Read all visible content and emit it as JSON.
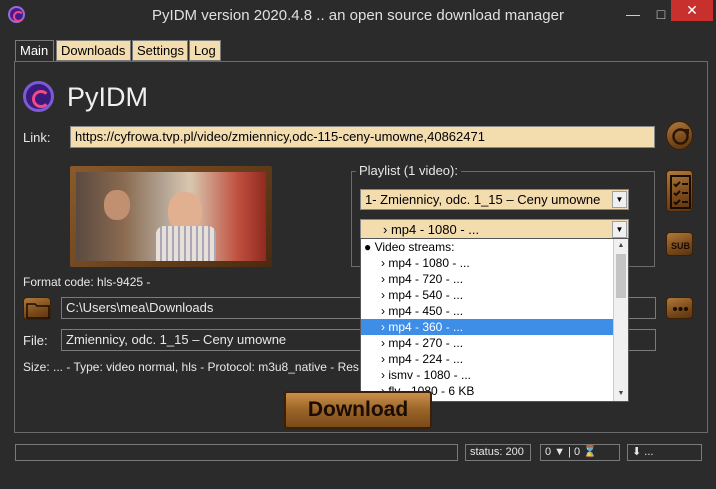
{
  "window": {
    "title": "PyIDM version 2020.4.8 .. an open source download manager",
    "minimize": "—",
    "maximize": "□",
    "close": "✕"
  },
  "tabs": [
    {
      "label": "Main",
      "active": true
    },
    {
      "label": "Downloads",
      "active": false
    },
    {
      "label": "Settings",
      "active": false
    },
    {
      "label": "Log",
      "active": false
    }
  ],
  "logo": {
    "text": "PyIDM"
  },
  "link": {
    "label": "Link:",
    "value": "https://cyfrowa.tvp.pl/video/zmiennicy,odc-115-ceny-umowne,40862471"
  },
  "playlist": {
    "legend": "Playlist (1 video):",
    "selected_video": "1- Zmiennicy, odc. 1_15 – Ceny umowne",
    "selected_stream": "› mp4 - 1080 - ...",
    "dropdown": {
      "header": "● Video streams:",
      "items": [
        "› mp4 - 1080 - ...",
        "› mp4 - 720 - ...",
        "› mp4 - 540 - ...",
        "› mp4 - 450 - ...",
        "› mp4 - 360 - ...",
        "› mp4 - 270 - ...",
        "› mp4 - 224 - ...",
        "› ismv - 1080 - ...",
        "› flv - 1080 - 6 KB"
      ],
      "selected_index": 4
    }
  },
  "format": {
    "text": "Format code: hls-9425 -"
  },
  "folder": {
    "value": "C:\\Users\\mea\\Downloads"
  },
  "file": {
    "label": "File:",
    "value": "Zmiennicy, odc. 1_15 – Ceny umowne"
  },
  "info": {
    "text": "Size: ... - Type: video normal, hls - Protocol: m3u8_native - Res"
  },
  "download": {
    "label": "Download"
  },
  "statusbar": {
    "status": "status: 200",
    "counters": "0 ▼ | 0 ⌛",
    "extra": "⬇ ..."
  },
  "colors": {
    "accent_field": "#f3dcae",
    "background": "#2b2b2b",
    "selected": "#3e8de6",
    "close": "#c7302c"
  }
}
